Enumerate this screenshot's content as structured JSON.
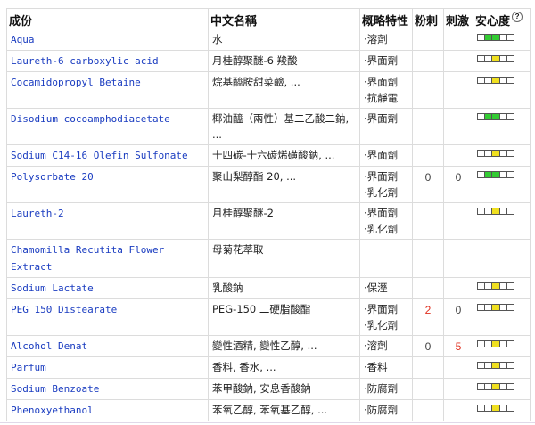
{
  "headers": {
    "ingredient": "成份",
    "chinese_name": "中文名稱",
    "function": "概略特性",
    "acne": "粉刺",
    "irritation": "刺激",
    "safety": "安心度"
  },
  "colors": {
    "green": "#33cc33",
    "yellow": "#f0e020"
  },
  "rows": [
    {
      "ingredient": "Aqua",
      "chinese": "水",
      "functions": [
        "溶劑"
      ],
      "acne": "",
      "irritation": "",
      "safety_color": "green"
    },
    {
      "ingredient": "Laureth-6 carboxylic acid",
      "chinese": "月桂醇聚醚-6 羧酸",
      "functions": [
        "界面劑"
      ],
      "acne": "",
      "irritation": "",
      "safety_color": "yellow"
    },
    {
      "ingredient": "Cocamidopropyl Betaine",
      "chinese": "烷基醯胺甜菜鹼, ...",
      "functions": [
        "界面劑",
        "抗靜電"
      ],
      "acne": "",
      "irritation": "",
      "safety_color": "yellow"
    },
    {
      "ingredient": "Disodium cocoamphodiacetate",
      "chinese": "椰油醯（兩性）基二乙酸二鈉, ...",
      "functions": [
        "界面劑"
      ],
      "acne": "",
      "irritation": "",
      "safety_color": "green"
    },
    {
      "ingredient": "Sodium C14-16 Olefin Sulfonate",
      "chinese": "十四碳-十六碳烯磺酸鈉, ...",
      "functions": [
        "界面劑"
      ],
      "acne": "",
      "irritation": "",
      "safety_color": "yellow"
    },
    {
      "ingredient": "Polysorbate 20",
      "chinese": "聚山梨醇酯 20, ...",
      "functions": [
        "界面劑",
        "乳化劑"
      ],
      "acne": "0",
      "irritation": "0",
      "safety_color": "green"
    },
    {
      "ingredient": "Laureth-2",
      "chinese": "月桂醇聚醚-2",
      "functions": [
        "界面劑",
        "乳化劑"
      ],
      "acne": "",
      "irritation": "",
      "safety_color": "yellow"
    },
    {
      "ingredient": "Chamomilla Recutita Flower Extract",
      "chinese": "母菊花萃取",
      "functions": [],
      "acne": "",
      "irritation": "",
      "safety_color": "none"
    },
    {
      "ingredient": "Sodium Lactate",
      "chinese": "乳酸鈉",
      "functions": [
        "保溼"
      ],
      "acne": "",
      "irritation": "",
      "safety_color": "yellow"
    },
    {
      "ingredient": "PEG 150 Distearate",
      "chinese": "PEG-150 二硬脂酸酯",
      "functions": [
        "界面劑",
        "乳化劑"
      ],
      "acne": "2",
      "irritation": "0",
      "safety_color": "yellow"
    },
    {
      "ingredient": "Alcohol Denat",
      "chinese": "變性酒精, 變性乙醇, ...",
      "functions": [
        "溶劑"
      ],
      "acne": "0",
      "irritation": "5",
      "safety_color": "yellow"
    },
    {
      "ingredient": "Parfum",
      "chinese": "香料, 香水, ...",
      "functions": [
        "香料"
      ],
      "acne": "",
      "irritation": "",
      "safety_color": "yellow"
    },
    {
      "ingredient": "Sodium Benzoate",
      "chinese": "苯甲酸鈉, 安息香酸鈉",
      "functions": [
        "防腐劑"
      ],
      "acne": "",
      "irritation": "",
      "safety_color": "yellow"
    },
    {
      "ingredient": "Phenoxyethanol",
      "chinese": "苯氧乙醇, 苯氧基乙醇, ...",
      "functions": [
        "防腐劑"
      ],
      "acne": "",
      "irritation": "",
      "safety_color": "yellow"
    }
  ]
}
